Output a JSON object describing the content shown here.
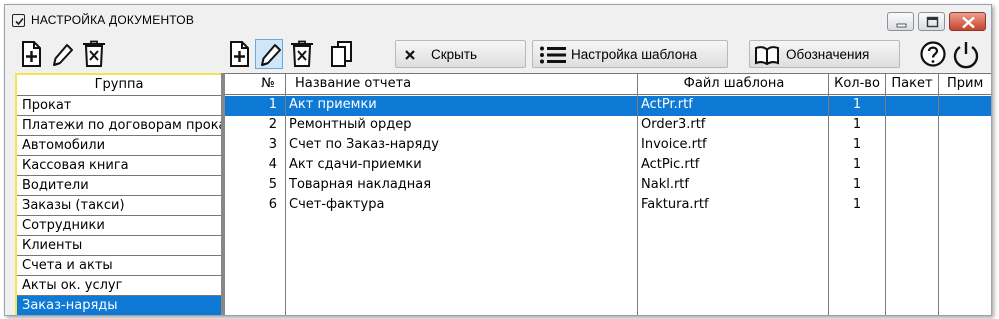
{
  "window": {
    "title": "НАСТРОЙКА ДОКУМЕНТОВ"
  },
  "toolbar": {
    "hide_label": "Скрыть",
    "template_settings_label": "Настройка шаблона",
    "legend_label": "Обозначения",
    "left_icons": [
      "add-document-icon",
      "edit-pencil-icon",
      "delete-document-icon"
    ],
    "right_icons": [
      "add-document-icon",
      "edit-pencil-icon",
      "delete-document-icon",
      "copy-icon"
    ],
    "help_icon": "help-icon",
    "power_icon": "power-icon"
  },
  "groups": {
    "header": "Группа",
    "items": [
      "Прокат",
      "Платежи по договорам проката",
      "Автомобили",
      "Кассовая книга",
      "Водители",
      "Заказы (такси)",
      "Сотрудники",
      "Клиенты",
      "Счета и акты",
      "Акты ок. услуг",
      "Заказ-наряды"
    ],
    "selected_index": 10
  },
  "reports": {
    "columns": [
      "№",
      "Название отчета",
      "Файл шаблона",
      "Кол-во",
      "Пакет",
      "Прим"
    ],
    "rows": [
      {
        "num": "1",
        "name": "Акт приемки",
        "file": "ActPr.rtf",
        "qty": "1"
      },
      {
        "num": "2",
        "name": "Ремонтный ордер",
        "file": "Order3.rtf",
        "qty": "1"
      },
      {
        "num": "3",
        "name": "Счет по Заказ-наряду",
        "file": "Invoice.rtf",
        "qty": "1"
      },
      {
        "num": "4",
        "name": "Акт сдачи-приемки",
        "file": "ActPic.rtf",
        "qty": "1"
      },
      {
        "num": "5",
        "name": "Товарная накладная",
        "file": "Nakl.rtf",
        "qty": "1"
      },
      {
        "num": "6",
        "name": "Счет-фактура",
        "file": "Faktura.rtf",
        "qty": "1"
      }
    ],
    "selected_index": 0
  },
  "colors": {
    "selection": "#0e7ad6",
    "group_border": "#f3e64a"
  }
}
